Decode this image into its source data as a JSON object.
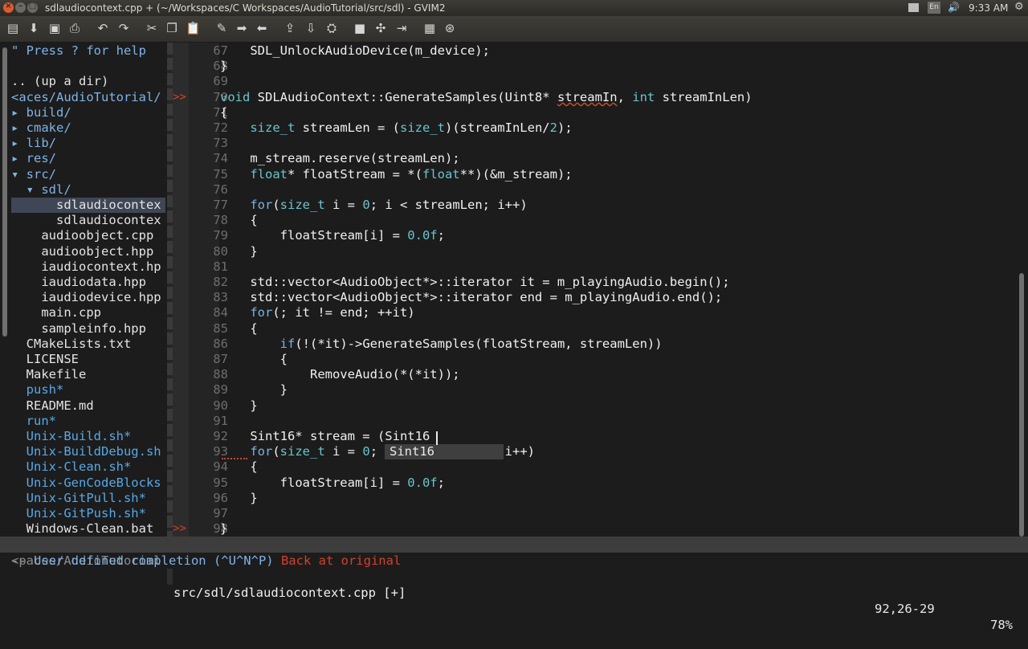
{
  "window": {
    "title": "sdlaudiocontext.cpp + (~/Workspaces/C Workspaces/AudioTutorial/src/sdl) - GVIM2",
    "close_glyph": "×",
    "min_glyph": "–",
    "max_glyph": "□",
    "accent_color": "#e05a2b"
  },
  "tray": {
    "language": "En",
    "volume_glyph": "🔊",
    "clock": "9:33 AM",
    "gear_glyph": "⚙"
  },
  "toolbar": {
    "icons": [
      "open-icon",
      "save-icon",
      "save-all-icon",
      "print-icon",
      "undo-icon",
      "redo-icon",
      "cut-icon",
      "copy-icon",
      "paste-icon",
      "replace-icon",
      "find-next-icon",
      "find-prev-icon",
      "load-session-icon",
      "save-session-icon",
      "run-script-icon",
      "make-icon",
      "build-tags-icon",
      "jump-tag-icon",
      "help-icon",
      "find-help-icon"
    ],
    "glyphs": [
      "▤",
      "⬇",
      "▣",
      "⎙",
      "↶",
      "↷",
      "✂",
      "❐",
      "📋",
      "✎",
      "➡",
      "⬅",
      "⇪",
      "⇩",
      "⛭",
      "■",
      "✣",
      "⇥",
      "▦",
      "⊛"
    ]
  },
  "tree": {
    "lines": [
      {
        "text": "\" Press ? for help",
        "kind": "help"
      },
      {
        "text": "",
        "kind": "file"
      },
      {
        "text": ".. (up a dir)",
        "kind": "file"
      },
      {
        "text": "<aces/AudioTutorial/",
        "kind": "dir"
      },
      {
        "text": "▸ build/",
        "kind": "dir"
      },
      {
        "text": "▸ cmake/",
        "kind": "dir"
      },
      {
        "text": "▸ lib/",
        "kind": "dir"
      },
      {
        "text": "▸ res/",
        "kind": "dir"
      },
      {
        "text": "▾ src/",
        "kind": "dir"
      },
      {
        "text": "  ▾ sdl/",
        "kind": "dir"
      },
      {
        "text": "      sdlaudiocontex",
        "kind": "selected"
      },
      {
        "text": "      sdlaudiocontex",
        "kind": "file"
      },
      {
        "text": "    audioobject.cpp",
        "kind": "file"
      },
      {
        "text": "    audioobject.hpp",
        "kind": "file"
      },
      {
        "text": "    iaudiocontext.hp",
        "kind": "file"
      },
      {
        "text": "    iaudiodata.hpp",
        "kind": "file"
      },
      {
        "text": "    iaudiodevice.hpp",
        "kind": "file"
      },
      {
        "text": "    main.cpp",
        "kind": "file"
      },
      {
        "text": "    sampleinfo.hpp",
        "kind": "file"
      },
      {
        "text": "  CMakeLists.txt",
        "kind": "file"
      },
      {
        "text": "  LICENSE",
        "kind": "file"
      },
      {
        "text": "  Makefile",
        "kind": "file"
      },
      {
        "text": "  push*",
        "kind": "exec"
      },
      {
        "text": "  README.md",
        "kind": "file"
      },
      {
        "text": "  run*",
        "kind": "exec"
      },
      {
        "text": "  Unix-Build.sh*",
        "kind": "exec"
      },
      {
        "text": "  Unix-BuildDebug.sh",
        "kind": "exec"
      },
      {
        "text": "  Unix-Clean.sh*",
        "kind": "exec"
      },
      {
        "text": "  Unix-GenCodeBlocks",
        "kind": "exec"
      },
      {
        "text": "  Unix-GitPull.sh*",
        "kind": "exec"
      },
      {
        "text": "  Unix-GitPush.sh*",
        "kind": "exec"
      },
      {
        "text": "  Windows-Clean.bat",
        "kind": "file"
      }
    ]
  },
  "code": {
    "lines": [
      {
        "n": "67",
        "sign": "",
        "segs": [
          [
            "",
            "    SDL_UnlockAudioDevice(m_device);"
          ]
        ]
      },
      {
        "n": "68",
        "sign": "",
        "segs": [
          [
            "",
            "}"
          ]
        ]
      },
      {
        "n": "69",
        "sign": "",
        "segs": []
      },
      {
        "n": "70",
        "sign": ">>",
        "segs": [
          [
            "ty",
            "void"
          ],
          [
            "",
            " SDLAudioContext::GenerateSamples(Uint8* "
          ],
          [
            "sq",
            "streamIn"
          ],
          [
            "",
            ", "
          ],
          [
            "ty",
            "int"
          ],
          [
            "",
            " streamInLen)"
          ]
        ]
      },
      {
        "n": "71",
        "sign": "",
        "segs": [
          [
            "",
            "{"
          ]
        ]
      },
      {
        "n": "72",
        "sign": "",
        "segs": [
          [
            "",
            "    "
          ],
          [
            "ty",
            "size_t"
          ],
          [
            "",
            " streamLen = ("
          ],
          [
            "ty",
            "size_t"
          ],
          [
            "",
            ")(streamInLen/"
          ],
          [
            "num",
            "2"
          ],
          [
            "",
            ");"
          ]
        ]
      },
      {
        "n": "73",
        "sign": "",
        "segs": []
      },
      {
        "n": "74",
        "sign": "",
        "segs": [
          [
            "",
            "    m_stream.reserve(streamLen);"
          ]
        ]
      },
      {
        "n": "75",
        "sign": "",
        "segs": [
          [
            "",
            "    "
          ],
          [
            "ty",
            "float"
          ],
          [
            "",
            "* floatStream = *("
          ],
          [
            "ty",
            "float"
          ],
          [
            "",
            "**)(&m_stream);"
          ]
        ]
      },
      {
        "n": "76",
        "sign": "",
        "segs": []
      },
      {
        "n": "77",
        "sign": "",
        "segs": [
          [
            "",
            "    "
          ],
          [
            "kw",
            "for"
          ],
          [
            "",
            "("
          ],
          [
            "ty",
            "size_t"
          ],
          [
            "",
            " i = "
          ],
          [
            "num",
            "0"
          ],
          [
            "",
            "; i < streamLen; i++)"
          ]
        ]
      },
      {
        "n": "78",
        "sign": "",
        "segs": [
          [
            "",
            "    {"
          ]
        ]
      },
      {
        "n": "79",
        "sign": "",
        "segs": [
          [
            "",
            "        floatStream[i] = "
          ],
          [
            "num",
            "0.0f"
          ],
          [
            "",
            ";"
          ]
        ]
      },
      {
        "n": "80",
        "sign": "",
        "segs": [
          [
            "",
            "    }"
          ]
        ]
      },
      {
        "n": "81",
        "sign": "",
        "segs": []
      },
      {
        "n": "82",
        "sign": "",
        "segs": [
          [
            "",
            "    std::vector<AudioObject*>::iterator it = m_playingAudio.begin();"
          ]
        ]
      },
      {
        "n": "83",
        "sign": "",
        "segs": [
          [
            "",
            "    std::vector<AudioObject*>::iterator end = m_playingAudio.end();"
          ]
        ]
      },
      {
        "n": "84",
        "sign": "",
        "segs": [
          [
            "",
            "    "
          ],
          [
            "kw",
            "for"
          ],
          [
            "",
            "(; it != end; ++it)"
          ]
        ]
      },
      {
        "n": "85",
        "sign": "",
        "segs": [
          [
            "",
            "    {"
          ]
        ]
      },
      {
        "n": "86",
        "sign": "",
        "segs": [
          [
            "",
            "        "
          ],
          [
            "kw",
            "if"
          ],
          [
            "",
            "(!(*it)->GenerateSamples(floatStream, streamLen))"
          ]
        ]
      },
      {
        "n": "87",
        "sign": "",
        "segs": [
          [
            "",
            "        {"
          ]
        ]
      },
      {
        "n": "88",
        "sign": "",
        "segs": [
          [
            "",
            "            RemoveAudio(*(*it));"
          ]
        ]
      },
      {
        "n": "89",
        "sign": "",
        "segs": [
          [
            "",
            "        }"
          ]
        ]
      },
      {
        "n": "90",
        "sign": "",
        "segs": [
          [
            "",
            "    }"
          ]
        ]
      },
      {
        "n": "91",
        "sign": "",
        "segs": []
      },
      {
        "n": "92",
        "sign": "",
        "segs": [
          [
            "",
            "    Sint16* stream = (Sint16"
          ]
        ]
      },
      {
        "n": "93",
        "sign": "",
        "segs": [
          [
            "",
            "    "
          ],
          [
            "kw",
            "for"
          ],
          [
            "",
            "("
          ],
          [
            "ty",
            "size_t"
          ],
          [
            "",
            " i = "
          ],
          [
            "num",
            "0"
          ],
          [
            "",
            ";                 i++)"
          ]
        ]
      },
      {
        "n": "94",
        "sign": "",
        "segs": [
          [
            "",
            "    {"
          ]
        ]
      },
      {
        "n": "95",
        "sign": "",
        "segs": [
          [
            "",
            "        floatStream[i] = "
          ],
          [
            "num",
            "0.0f"
          ],
          [
            "",
            ";"
          ]
        ]
      },
      {
        "n": "96",
        "sign": "",
        "segs": [
          [
            "",
            "    }"
          ]
        ]
      },
      {
        "n": "97",
        "sign": "",
        "segs": []
      },
      {
        "n": "98",
        "sign": ">>",
        "segs": [
          [
            "",
            "}"
          ]
        ]
      }
    ],
    "completion_item": "Sint16"
  },
  "status": {
    "tree_path": "<paces/AudioTutorial",
    "file": "src/sdl/sdlaudiocontext.cpp [+]",
    "position": "92,26-29",
    "percent": "78%"
  },
  "cmdline": {
    "message": "-- User defined completion (^U^N^P)",
    "back": "Back at original"
  },
  "colors": {
    "keyword": "#74b4e2",
    "type": "#6ac4cc",
    "sign": "#d4402a",
    "background": "#1c1c1c"
  }
}
